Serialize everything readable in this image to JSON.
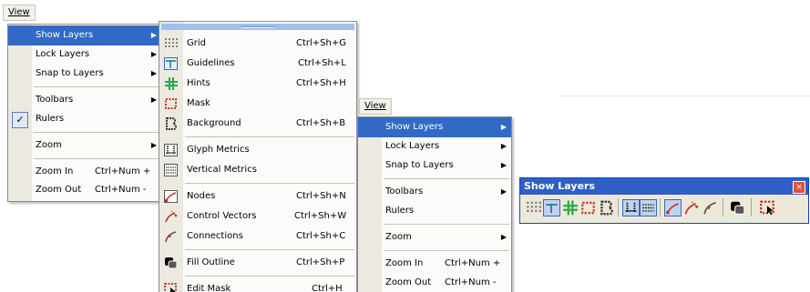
{
  "left": {
    "view_label": "View",
    "view_menu": [
      {
        "label": "Show Layers",
        "submenu": true,
        "highlight": true
      },
      {
        "label": "Lock Layers",
        "submenu": true
      },
      {
        "label": "Snap to Layers",
        "submenu": true
      },
      {
        "label": "Toolbars",
        "submenu": true
      },
      {
        "label": "Rulers",
        "checked": true
      },
      {
        "label": "Zoom",
        "submenu": true
      },
      {
        "label": "Zoom In",
        "shortcut": "Ctrl+Num +"
      },
      {
        "label": "Zoom Out",
        "shortcut": "Ctrl+Num -"
      }
    ],
    "layers_submenu": [
      {
        "label": "Grid",
        "shortcut": "Ctrl+Sh+G",
        "icon": "grid-icon"
      },
      {
        "label": "Guidelines",
        "shortcut": "Ctrl+Sh+L",
        "icon": "guidelines-icon"
      },
      {
        "label": "Hints",
        "shortcut": "Ctrl+Sh+H",
        "icon": "hints-icon"
      },
      {
        "label": "Mask",
        "shortcut": "",
        "icon": "mask-icon"
      },
      {
        "label": "Background",
        "shortcut": "Ctrl+Sh+B",
        "icon": "background-icon"
      },
      {
        "label": "Glyph Metrics",
        "shortcut": "",
        "icon": "glyph-metrics-icon"
      },
      {
        "label": "Vertical Metrics",
        "shortcut": "",
        "icon": "vertical-metrics-icon"
      },
      {
        "label": "Nodes",
        "shortcut": "Ctrl+Sh+N",
        "icon": "nodes-icon"
      },
      {
        "label": "Control Vectors",
        "shortcut": "Ctrl+Sh+W",
        "icon": "control-vectors-icon"
      },
      {
        "label": "Connections",
        "shortcut": "Ctrl+Sh+C",
        "icon": "connections-icon"
      },
      {
        "label": "Fill Outline",
        "shortcut": "Ctrl+Sh+P",
        "icon": "fill-outline-icon"
      },
      {
        "label": "Edit Mask",
        "shortcut": "Ctrl+H",
        "icon": "edit-mask-icon"
      }
    ]
  },
  "right": {
    "view_label": "View",
    "view_menu": [
      {
        "label": "Show Layers",
        "submenu": true,
        "highlight": true
      },
      {
        "label": "Lock Layers",
        "submenu": true
      },
      {
        "label": "Snap to Layers",
        "submenu": true
      },
      {
        "label": "Toolbars",
        "submenu": true
      },
      {
        "label": "Rulers"
      },
      {
        "label": "Zoom",
        "submenu": true
      },
      {
        "label": "Zoom In",
        "shortcut": "Ctrl+Num +"
      },
      {
        "label": "Zoom Out",
        "shortcut": "Ctrl+Num -"
      }
    ]
  },
  "toolbar": {
    "title": "Show Layers",
    "close_glyph": "×",
    "icons": [
      "grid-icon",
      "guidelines-icon",
      "hints-icon",
      "mask-icon",
      "background-icon",
      "glyph-metrics-icon",
      "vertical-metrics-icon",
      "nodes-icon",
      "control-vectors-icon",
      "connections-icon",
      "fill-outline-icon",
      "edit-mask-icon"
    ]
  },
  "glyphs": {
    "arrow": "▶",
    "check": "✓"
  }
}
